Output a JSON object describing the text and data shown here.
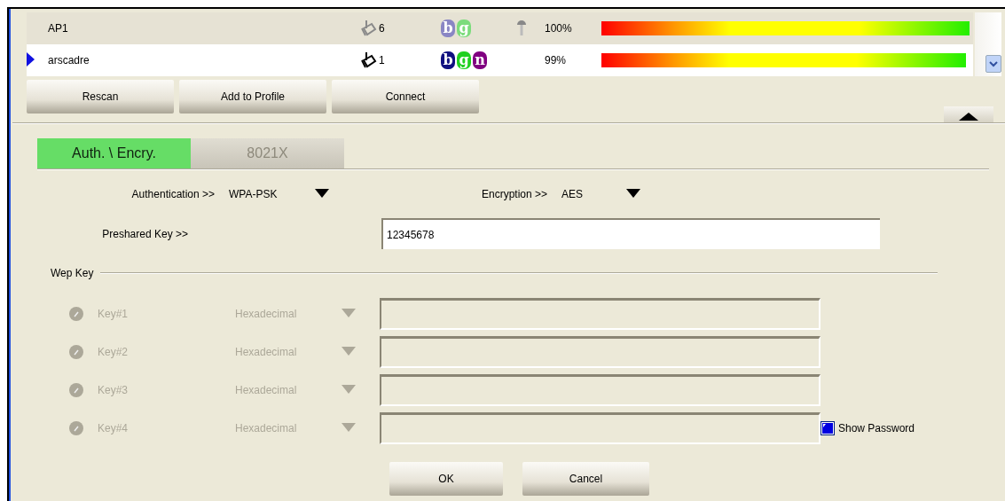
{
  "networks": [
    {
      "name": "AP1",
      "channel": "6",
      "modes": [
        {
          "label": "b",
          "color": "#8a86c4"
        },
        {
          "label": "g",
          "color": "#7cdc7c"
        }
      ],
      "secured": true,
      "signal": "100%",
      "level": 1.0,
      "selected": false
    },
    {
      "name": "arscadre",
      "channel": "1",
      "modes": [
        {
          "label": "b",
          "color": "#101080"
        },
        {
          "label": "g",
          "color": "#20d020"
        },
        {
          "label": "n",
          "color": "#800080"
        }
      ],
      "secured": false,
      "signal": "99%",
      "level": 0.99,
      "selected": true
    }
  ],
  "actions": [
    "Rescan",
    "Add to Profile",
    "Connect"
  ],
  "tabs": [
    {
      "label": "Auth. \\ Encry.",
      "selected": true
    },
    {
      "label": "8021X",
      "selected": false
    }
  ],
  "authentication": {
    "label": "Authentication >>",
    "value": "WPA-PSK"
  },
  "encryption": {
    "label": "Encryption >>",
    "value": "AES"
  },
  "preshared_key": {
    "label": "Preshared Key >>",
    "value": "12345678"
  },
  "wep_key": {
    "title": "Wep Key",
    "disabled": true,
    "keys": [
      {
        "label": "Key#1",
        "format": "Hexadecimal"
      },
      {
        "label": "Key#2",
        "format": "Hexadecimal"
      },
      {
        "label": "Key#3",
        "format": "Hexadecimal"
      },
      {
        "label": "Key#4",
        "format": "Hexadecimal"
      }
    ]
  },
  "show_password": {
    "label": "Show Password",
    "checked": true
  },
  "buttons": [
    "OK",
    "Cancel"
  ]
}
